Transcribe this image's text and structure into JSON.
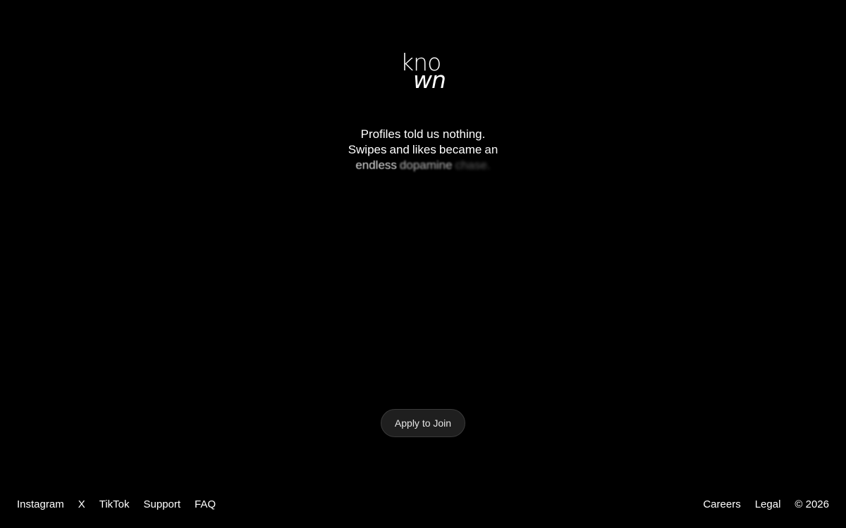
{
  "logo": {
    "line1": "kno",
    "line2": "wn"
  },
  "tagline": {
    "line1": "Profiles told us nothing.",
    "line2_words": [
      "Swipes",
      "and",
      "likes",
      "became",
      "an"
    ],
    "line3_words": [
      "endless",
      "dopamine",
      "chase."
    ]
  },
  "cta": {
    "label": "Apply to Join"
  },
  "footer": {
    "left_links": [
      "Instagram",
      "X",
      "TikTok",
      "Support",
      "FAQ"
    ],
    "right_links": [
      "Careers",
      "Legal"
    ],
    "copyright": "© 2026"
  },
  "colors": {
    "background": "#000000",
    "text": "#ffffff",
    "button_bg": "#1f1f1f",
    "button_border": "#3a3a3a"
  }
}
